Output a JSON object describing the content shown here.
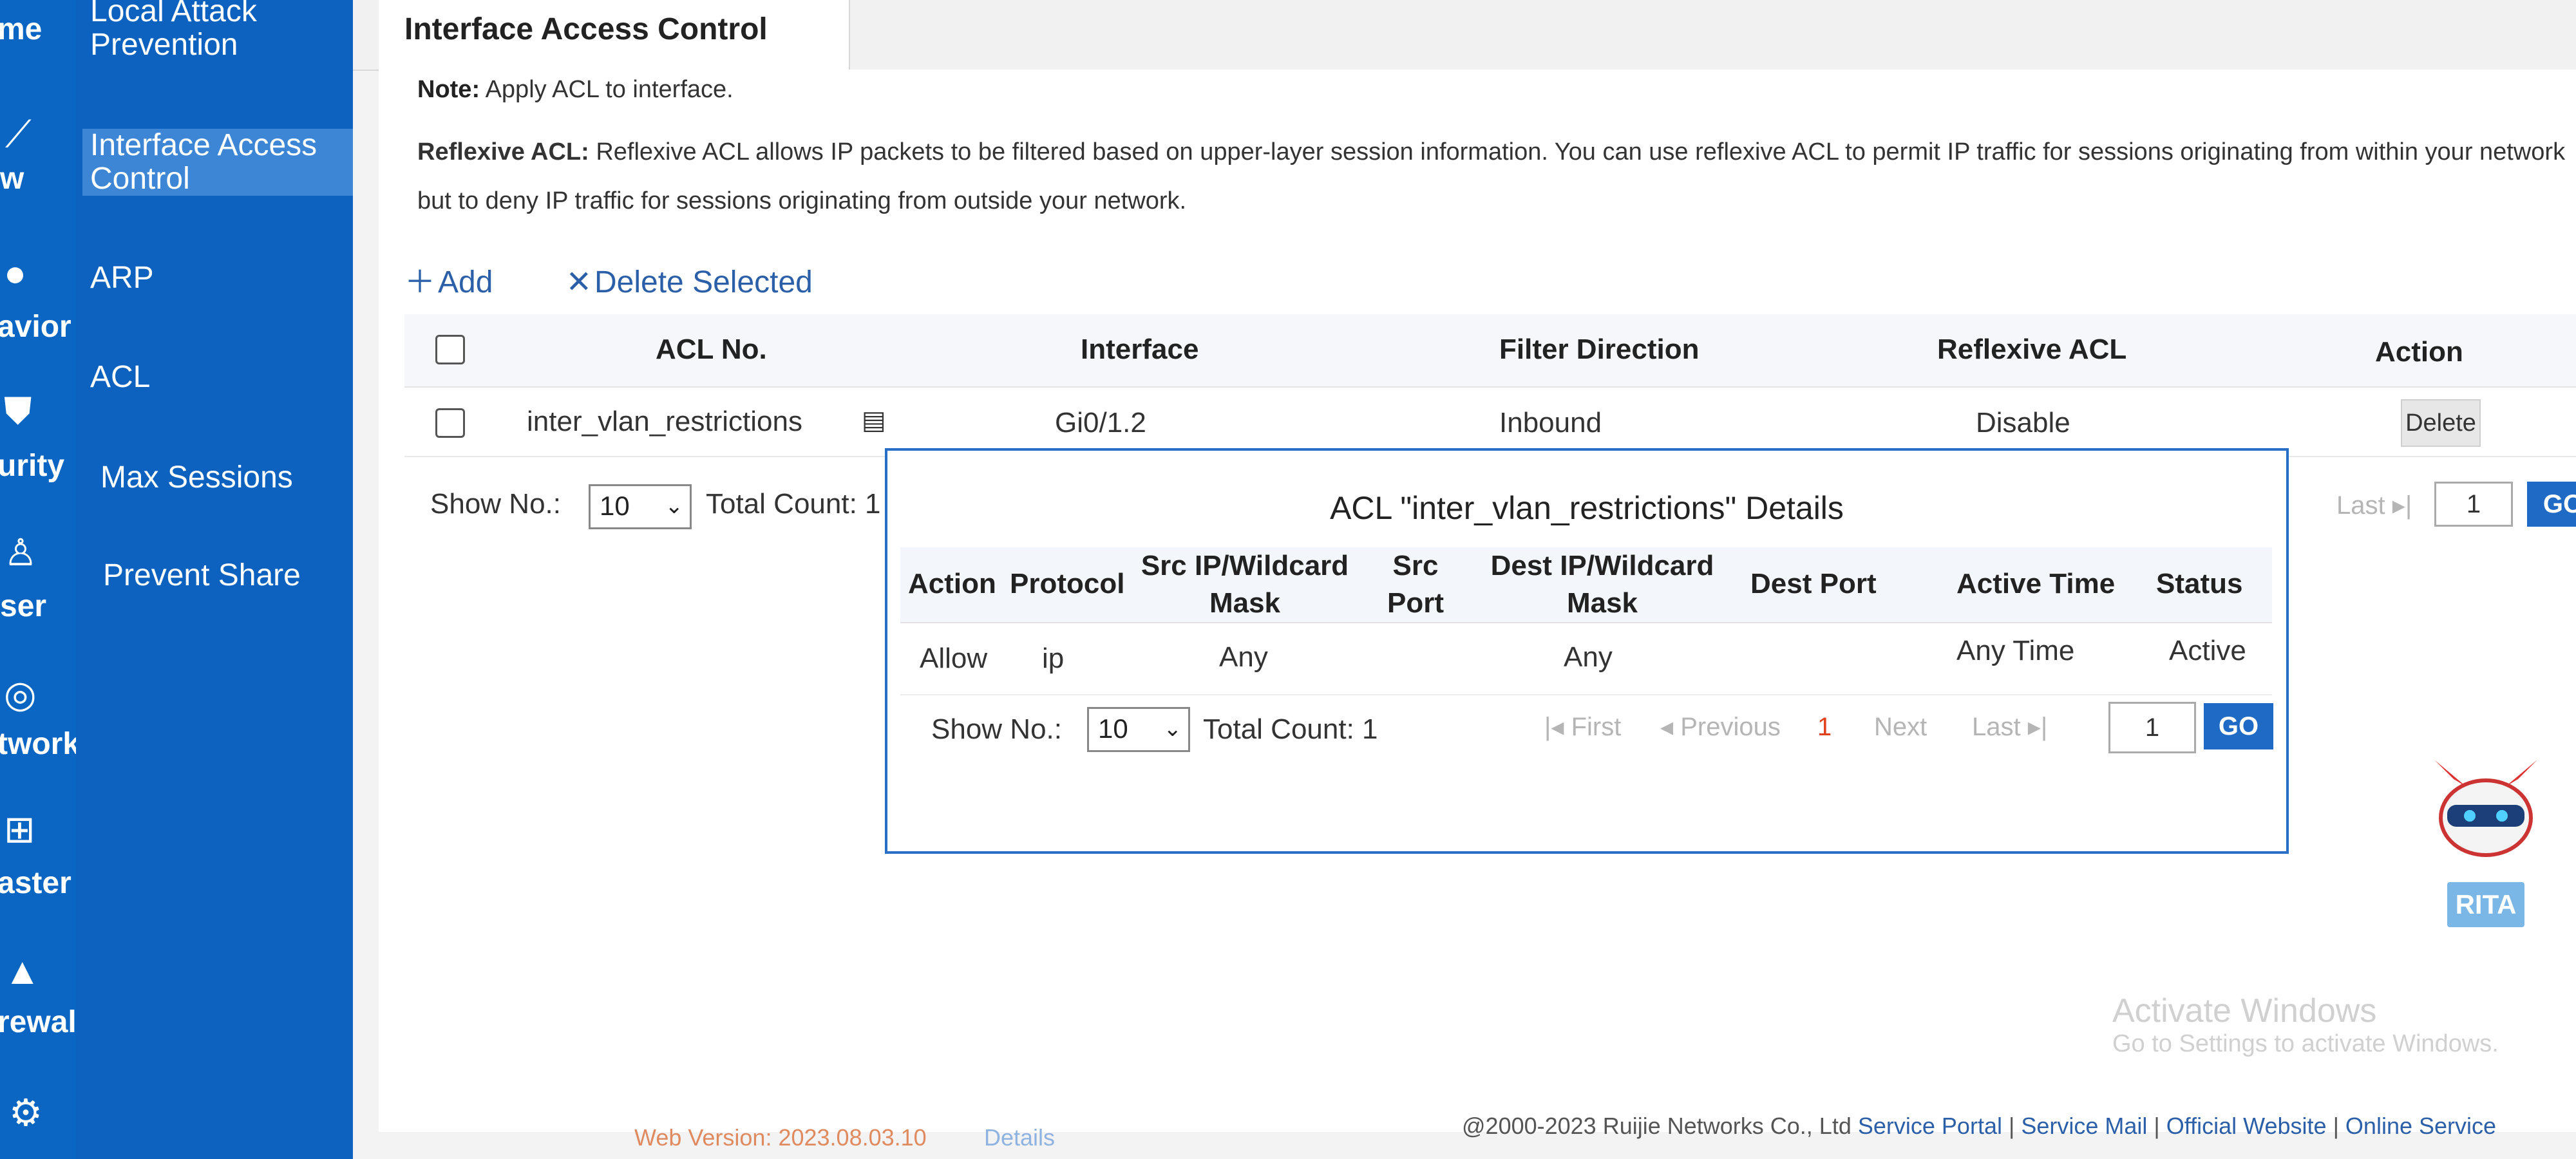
{
  "rail": {
    "items": [
      {
        "label": "me",
        "icon": "home-icon"
      },
      {
        "label": "w",
        "icon": "flow-icon"
      },
      {
        "label": "avior",
        "icon": "behavior-icon"
      },
      {
        "label": "urity",
        "icon": "security-shield-icon"
      },
      {
        "label": "ser",
        "icon": "user-icon"
      },
      {
        "label": "twork",
        "icon": "network-icon"
      },
      {
        "label": "aster",
        "icon": "cluster-icon"
      },
      {
        "label": "rewall",
        "icon": "firewall-icon"
      },
      {
        "label": "",
        "icon": "gear-icon"
      }
    ]
  },
  "menu": {
    "items": [
      {
        "label": "Local Attack Prevention"
      },
      {
        "label": "Interface Access Control"
      },
      {
        "label": "ARP"
      },
      {
        "label": "ACL"
      },
      {
        "label": "Max Sessions"
      },
      {
        "label": "Prevent Share"
      }
    ]
  },
  "tab": {
    "title": "Interface Access Control"
  },
  "note": {
    "label": "Note:",
    "text": "Apply ACL to interface."
  },
  "reflexive": {
    "label": "Reflexive ACL:",
    "text": "Reflexive ACL allows IP packets to be filtered based on upper-layer session information. You can use reflexive ACL to permit IP traffic for sessions originating from within your network but to deny IP traffic for sessions originating from outside your network."
  },
  "toolbar": {
    "add": "Add",
    "delete_selected": "Delete Selected"
  },
  "table": {
    "headers": [
      "ACL No.",
      "Interface",
      "Filter Direction",
      "Reflexive ACL",
      "Action"
    ],
    "rows": [
      {
        "acl_no": "inter_vlan_restrictions",
        "interface": "Gi0/1.2",
        "direction": "Inbound",
        "reflexive": "Disable",
        "action": "Delete"
      }
    ]
  },
  "pager": {
    "show_label": "Show No.:",
    "show_value": "10",
    "total": "Total Count: 1",
    "last": "Last",
    "page": "1",
    "go": "GO"
  },
  "popup": {
    "title": "ACL \"inter_vlan_restrictions\" Details",
    "headers": [
      "Action",
      "Protocol",
      "Src IP/Wildcard Mask",
      "Src Port",
      "Dest IP/Wildcard Mask",
      "Dest Port",
      "Active Time",
      "Status"
    ],
    "row": {
      "action": "Allow",
      "protocol": "ip",
      "src_ip": "Any",
      "src_port": "",
      "dest_ip": "Any",
      "dest_port": "",
      "active_time": "Any Time",
      "status": "Active"
    },
    "pager": {
      "show_label": "Show No.:",
      "show_value": "10",
      "total": "Total Count: 1",
      "first": "First",
      "previous": "Previous",
      "current": "1",
      "next": "Next",
      "last": "Last",
      "page": "1",
      "go": "GO"
    }
  },
  "footer": {
    "web_version": "Web Version: 2023.08.03.10",
    "details": "Details",
    "copyright": "@2000-2023 Ruijie Networks Co., Ltd",
    "links": [
      "Service Portal",
      "Service Mail",
      "Official Website",
      "Online Service"
    ]
  },
  "mascot": {
    "label": "RITA"
  },
  "watermark": {
    "title": "Activate Windows",
    "subtitle": "Go to Settings to activate Windows."
  },
  "colors": {
    "sidebar": "#0b66c3",
    "accent": "#1f6ac4",
    "active_page": "#e0401a"
  }
}
